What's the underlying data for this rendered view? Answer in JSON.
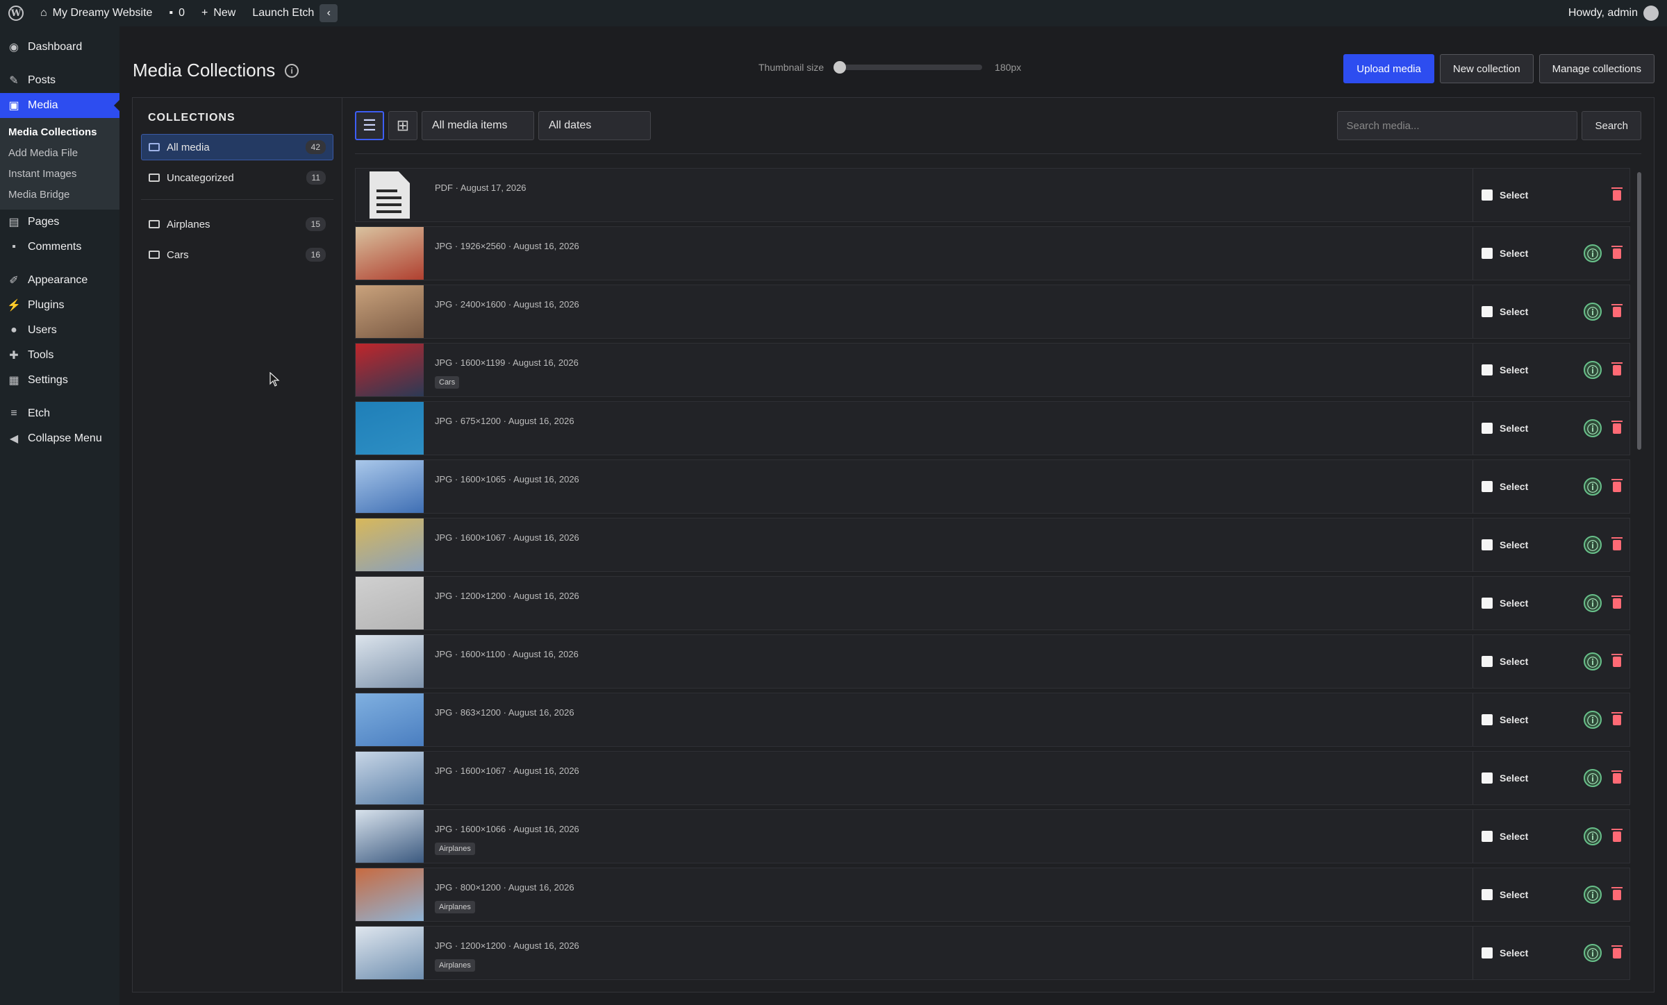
{
  "adminbar": {
    "site_name": "My Dreamy Website",
    "comments_count": "0",
    "new_label": "New",
    "launch_label": "Launch Etch",
    "howdy": "Howdy, admin"
  },
  "sidebar": {
    "items": [
      {
        "label": "Dashboard",
        "icon": "dashboard-icon"
      },
      {
        "label": "Posts",
        "icon": "pin-icon"
      },
      {
        "label": "Media",
        "icon": "media-icon"
      },
      {
        "label": "Pages",
        "icon": "pages-icon"
      },
      {
        "label": "Comments",
        "icon": "comment-icon"
      },
      {
        "label": "Appearance",
        "icon": "brush-icon"
      },
      {
        "label": "Plugins",
        "icon": "plug-icon"
      },
      {
        "label": "Users",
        "icon": "user-icon"
      },
      {
        "label": "Tools",
        "icon": "wrench-icon"
      },
      {
        "label": "Settings",
        "icon": "settings-icon"
      },
      {
        "label": "Etch",
        "icon": "etch-icon"
      },
      {
        "label": "Collapse Menu",
        "icon": "collapse-icon"
      }
    ],
    "media_submenu": [
      "Media Collections",
      "Add Media File",
      "Instant Images",
      "Media Bridge"
    ]
  },
  "header": {
    "title": "Media Collections",
    "thumb_label": "Thumbnail size",
    "thumb_value": "180px",
    "thumb_level": 0.0,
    "buttons": {
      "upload": "Upload media",
      "new_collection": "New collection",
      "manage": "Manage collections"
    }
  },
  "collections": {
    "title": "COLLECTIONS",
    "items": [
      {
        "label": "All media",
        "count": "42"
      },
      {
        "label": "Uncategorized",
        "count": "11"
      },
      {
        "label": "Airplanes",
        "count": "15"
      },
      {
        "label": "Cars",
        "count": "16"
      }
    ]
  },
  "filters": {
    "type": "All media items",
    "dates": "All dates",
    "search_placeholder": "Search media...",
    "search_button": "Search"
  },
  "select_label": "Select",
  "media": [
    {
      "meta": "PDF · August 17, 2026",
      "tag": "",
      "kind": "pdf",
      "colors": [
        "#ffffff",
        "#e9e9e9"
      ]
    },
    {
      "meta": "JPG · 1926×2560 · August 16, 2026",
      "tag": "",
      "kind": "img",
      "colors": [
        "#b04030",
        "#d9c3a0"
      ]
    },
    {
      "meta": "JPG · 2400×1600 · August 16, 2026",
      "tag": "",
      "kind": "img",
      "colors": [
        "#7a5a44",
        "#c9a27c"
      ]
    },
    {
      "meta": "JPG · 1600×1199 · August 16, 2026",
      "tag": "Cars",
      "kind": "img",
      "colors": [
        "#2b3a55",
        "#c0262b"
      ]
    },
    {
      "meta": "JPG · 675×1200 · August 16, 2026",
      "tag": "",
      "kind": "img",
      "colors": [
        "#2e8fc4",
        "#1f7fb8"
      ]
    },
    {
      "meta": "JPG · 1600×1065 · August 16, 2026",
      "tag": "",
      "kind": "img",
      "colors": [
        "#3f6fb4",
        "#aac8ea"
      ]
    },
    {
      "meta": "JPG · 1600×1067 · August 16, 2026",
      "tag": "",
      "kind": "img",
      "colors": [
        "#8aa0bb",
        "#d8b85a"
      ]
    },
    {
      "meta": "JPG · 1200×1200 · August 16, 2026",
      "tag": "",
      "kind": "img",
      "colors": [
        "#b4b4b4",
        "#d0d0d0"
      ]
    },
    {
      "meta": "JPG · 1600×1100 · August 16, 2026",
      "tag": "",
      "kind": "img",
      "colors": [
        "#7f94ad",
        "#dce4ec"
      ]
    },
    {
      "meta": "JPG · 863×1200 · August 16, 2026",
      "tag": "",
      "kind": "img",
      "colors": [
        "#4a7ec0",
        "#80b0e0"
      ]
    },
    {
      "meta": "JPG · 1600×1067 · August 16, 2026",
      "tag": "",
      "kind": "img",
      "colors": [
        "#5a7fa8",
        "#c8d6e6"
      ]
    },
    {
      "meta": "JPG · 1600×1066 · August 16, 2026",
      "tag": "Airplanes",
      "kind": "img",
      "colors": [
        "#3c5a80",
        "#d8e2ec"
      ]
    },
    {
      "meta": "JPG · 800×1200 · August 16, 2026",
      "tag": "Airplanes",
      "kind": "img",
      "colors": [
        "#8fb4d6",
        "#c86a40"
      ]
    },
    {
      "meta": "JPG · 1200×1200 · August 16, 2026",
      "tag": "Airplanes",
      "kind": "img",
      "colors": [
        "#6f8fb0",
        "#dfe6ee"
      ]
    }
  ]
}
